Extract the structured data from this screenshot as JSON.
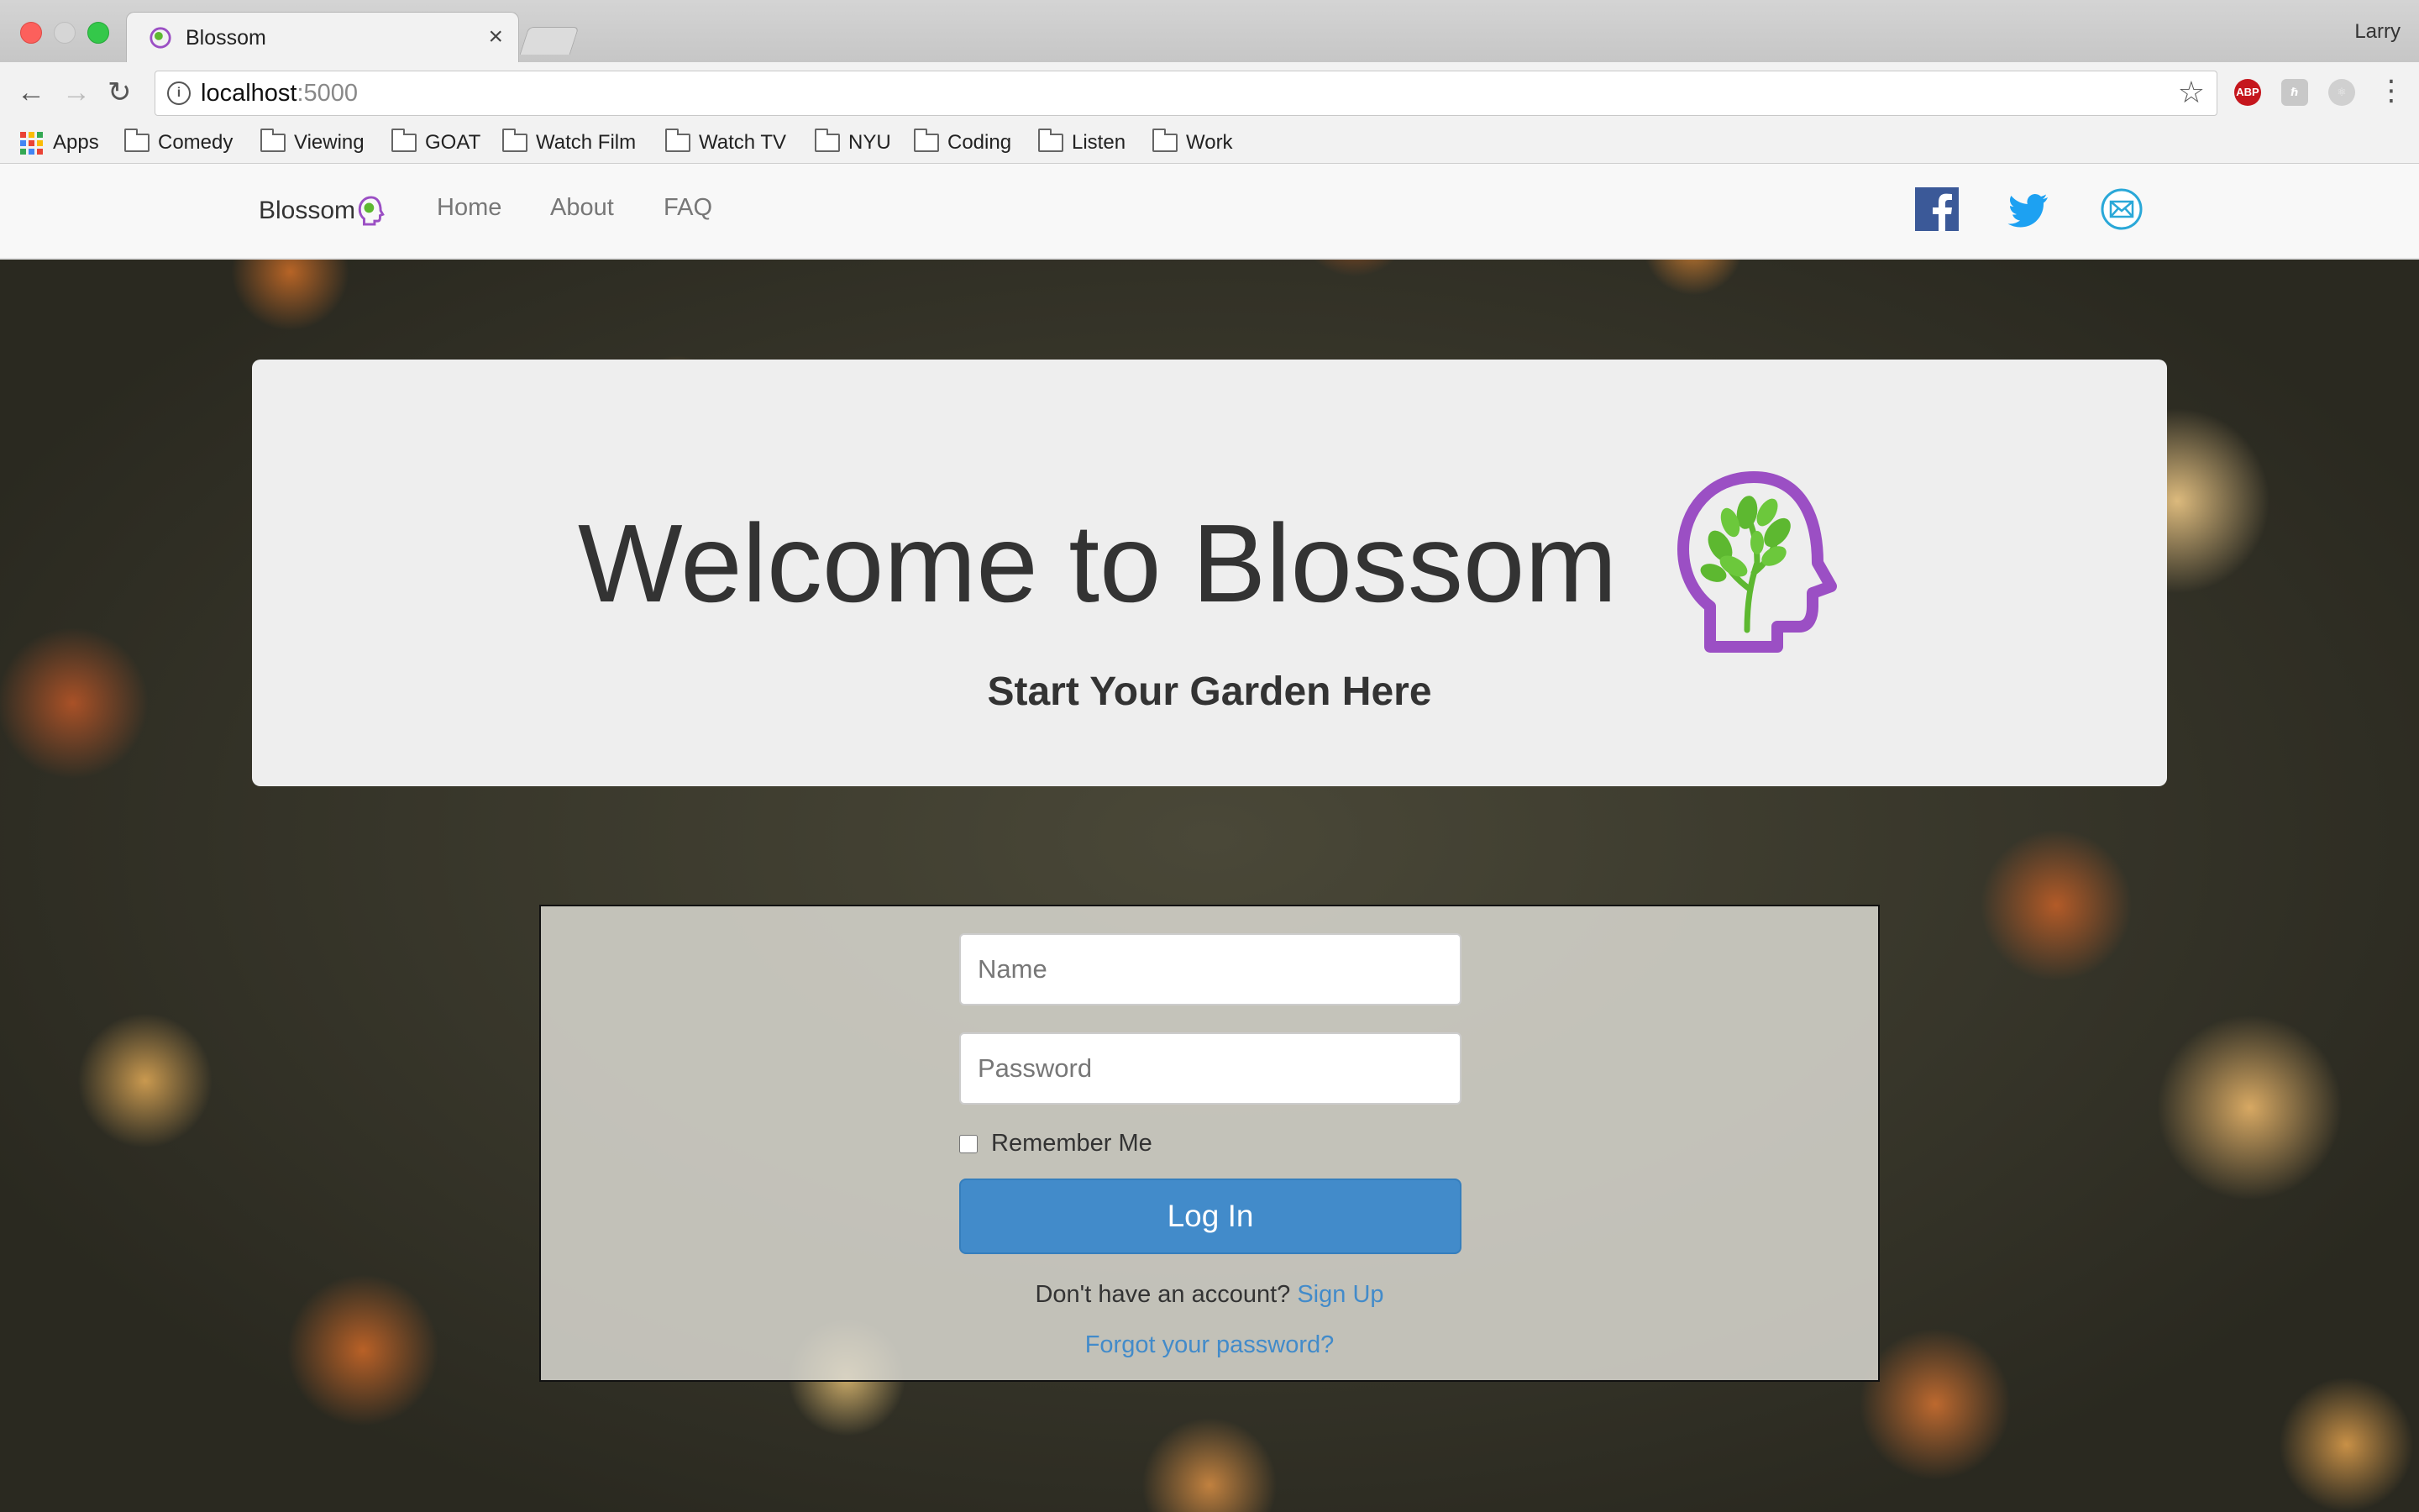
{
  "browser": {
    "tab_title": "Blossom",
    "tab_close": "×",
    "profile_name": "Larry",
    "url_host": "localhost",
    "url_port": ":5000",
    "extensions": [
      "ABP",
      "ℏ",
      "⚛"
    ],
    "bookmarks": [
      {
        "label": "Apps",
        "icon": "apps-grid-icon"
      },
      {
        "label": "Comedy",
        "icon": "folder-icon"
      },
      {
        "label": "Viewing",
        "icon": "folder-icon"
      },
      {
        "label": "GOAT",
        "icon": "folder-icon"
      },
      {
        "label": "Watch Film",
        "icon": "folder-icon"
      },
      {
        "label": "Watch TV",
        "icon": "folder-icon"
      },
      {
        "label": "NYU",
        "icon": "folder-icon"
      },
      {
        "label": "Coding",
        "icon": "folder-icon"
      },
      {
        "label": "Listen",
        "icon": "folder-icon"
      },
      {
        "label": "Work",
        "icon": "folder-icon"
      }
    ]
  },
  "navbar": {
    "brand": "Blossom",
    "links": [
      "Home",
      "About",
      "FAQ"
    ],
    "social": [
      "facebook-icon",
      "twitter-icon",
      "email-icon"
    ]
  },
  "hero": {
    "title": "Welcome to Blossom",
    "subtitle": "Start Your Garden Here"
  },
  "login": {
    "name_placeholder": "Name",
    "password_placeholder": "Password",
    "remember_label": "Remember Me",
    "button_label": "Log In",
    "signup_prompt": "Don't have an account?",
    "signup_link": "Sign Up",
    "forgot_link": "Forgot your password?"
  },
  "colors": {
    "primary_button": "#428bca",
    "link": "#428bca",
    "logo_purple": "#9b4fc4",
    "logo_green": "#5db830",
    "facebook": "#3b5998",
    "twitter": "#1da1f2"
  }
}
